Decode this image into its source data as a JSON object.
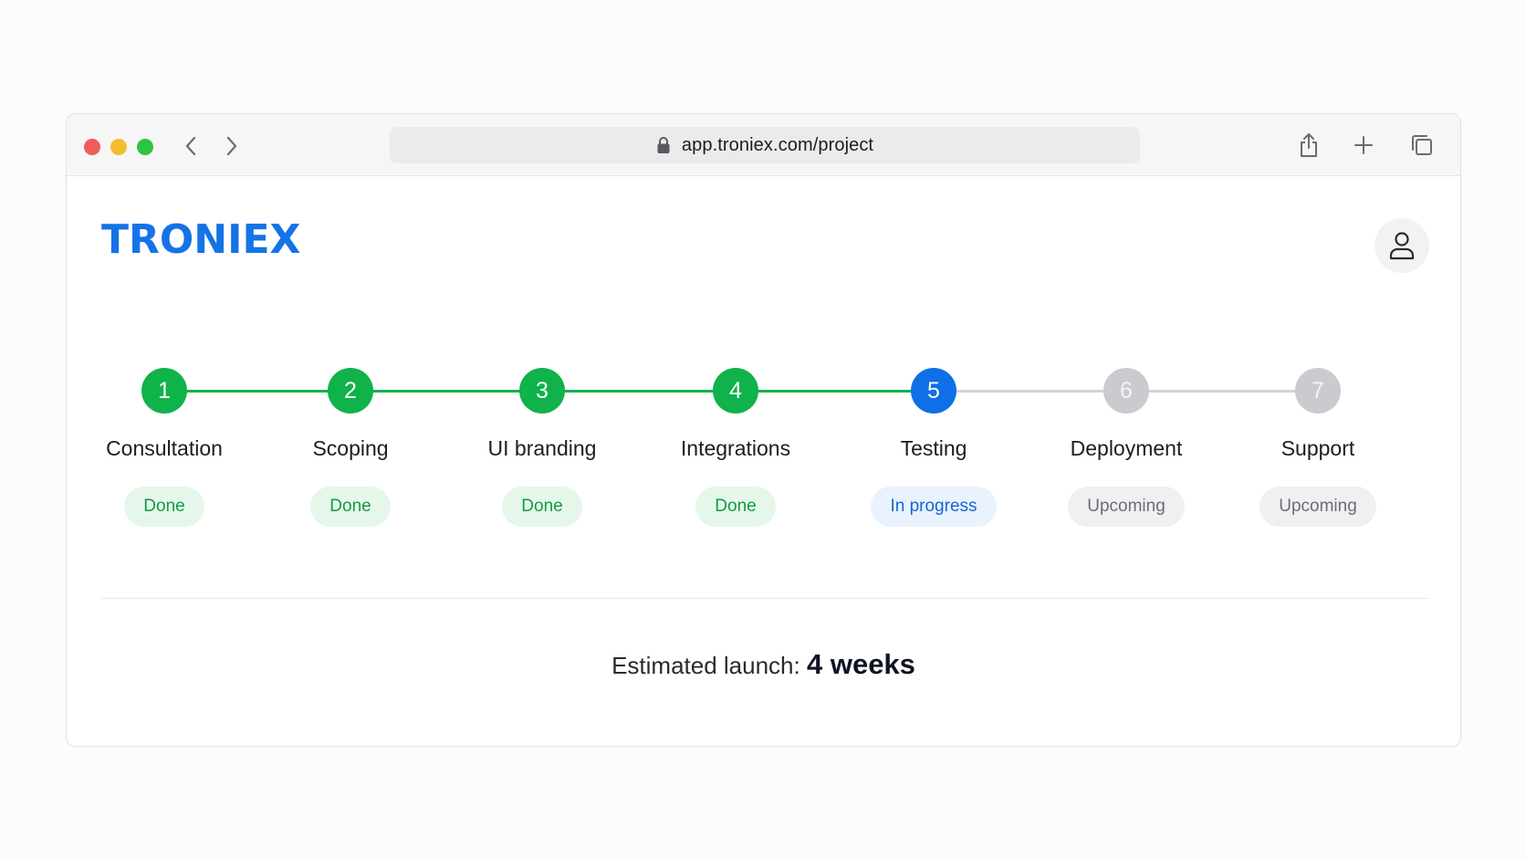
{
  "browser": {
    "url": "app.troniex.com/project",
    "icons": {
      "back": "chevron-left-icon",
      "forward": "chevron-right-icon",
      "lock": "lock-icon",
      "share": "share-icon",
      "new_tab": "plus-icon",
      "tabs": "tabs-overview-icon"
    }
  },
  "app": {
    "logo": "TRONIEX",
    "brand_color": "#1473e6",
    "account_icon": "user-icon"
  },
  "steps": [
    {
      "number": "1",
      "label": "Consultation",
      "status": "Done"
    },
    {
      "number": "2",
      "label": "Scoping",
      "status": "Done"
    },
    {
      "number": "3",
      "label": "UI branding",
      "status": "Done"
    },
    {
      "number": "4",
      "label": "Integrations",
      "status": "Done"
    },
    {
      "number": "5",
      "label": "Testing",
      "status": "In progress"
    },
    {
      "number": "6",
      "label": "Deployment",
      "status": "Upcoming"
    },
    {
      "number": "7",
      "label": "Support",
      "status": "Upcoming"
    }
  ],
  "status_colors": {
    "Done": "#10b24a",
    "In progress": "#0f6fe6",
    "Upcoming": "#c9cbcf"
  },
  "summary": {
    "label": "Estimated launch:",
    "value": "4 weeks"
  }
}
